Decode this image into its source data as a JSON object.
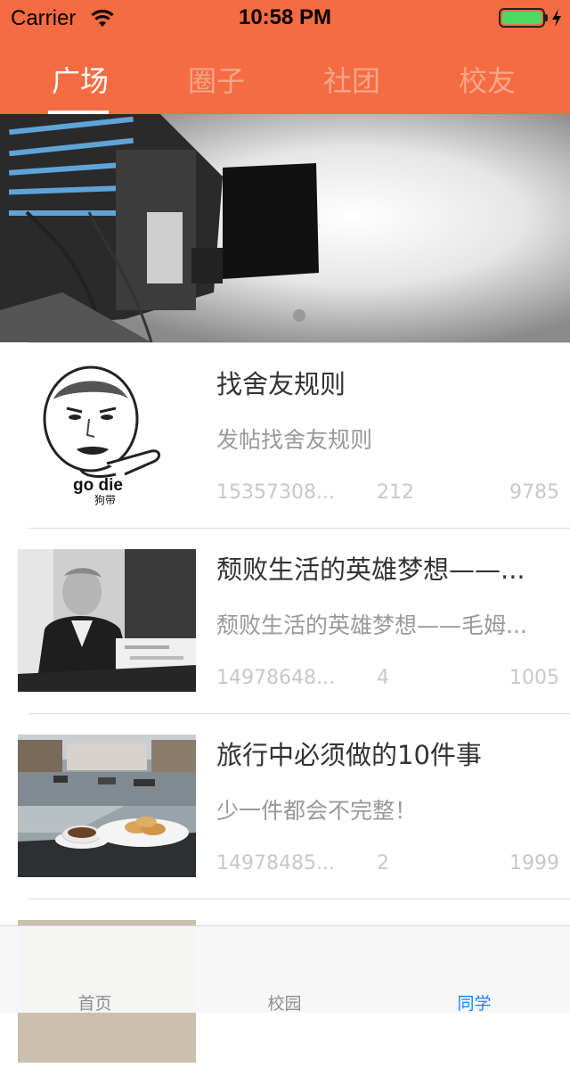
{
  "status_bar": {
    "carrier": "Carrier",
    "time": "10:58 PM"
  },
  "top_tabs": [
    {
      "label": "广场",
      "active": true
    },
    {
      "label": "圈子",
      "active": false
    },
    {
      "label": "社团",
      "active": false
    },
    {
      "label": "校友",
      "active": false
    }
  ],
  "banner": {
    "page_indicator_count": 1
  },
  "posts": [
    {
      "title": "找舍友规则",
      "desc": "发帖找舍友规则",
      "meta1": "15357308...",
      "meta2": "212",
      "meta3": "9785",
      "thumb_caption": "go die",
      "thumb_subcaption": "狗带"
    },
    {
      "title": "颓败生活的英雄梦想——...",
      "desc": "颓败生活的英雄梦想——毛姆...",
      "meta1": "14978648...",
      "meta2": "4",
      "meta3": "1005"
    },
    {
      "title": "旅行中必须做的10件事",
      "desc": "少一件都会不完整！",
      "meta1": "14978485...",
      "meta2": "2",
      "meta3": "1999"
    }
  ],
  "bottom_tabs": [
    {
      "label": "首页",
      "active": false
    },
    {
      "label": "校园",
      "active": false
    },
    {
      "label": "同学",
      "active": true
    }
  ],
  "colors": {
    "accent": "#f56c42",
    "tab_active": "#1a82fb"
  }
}
